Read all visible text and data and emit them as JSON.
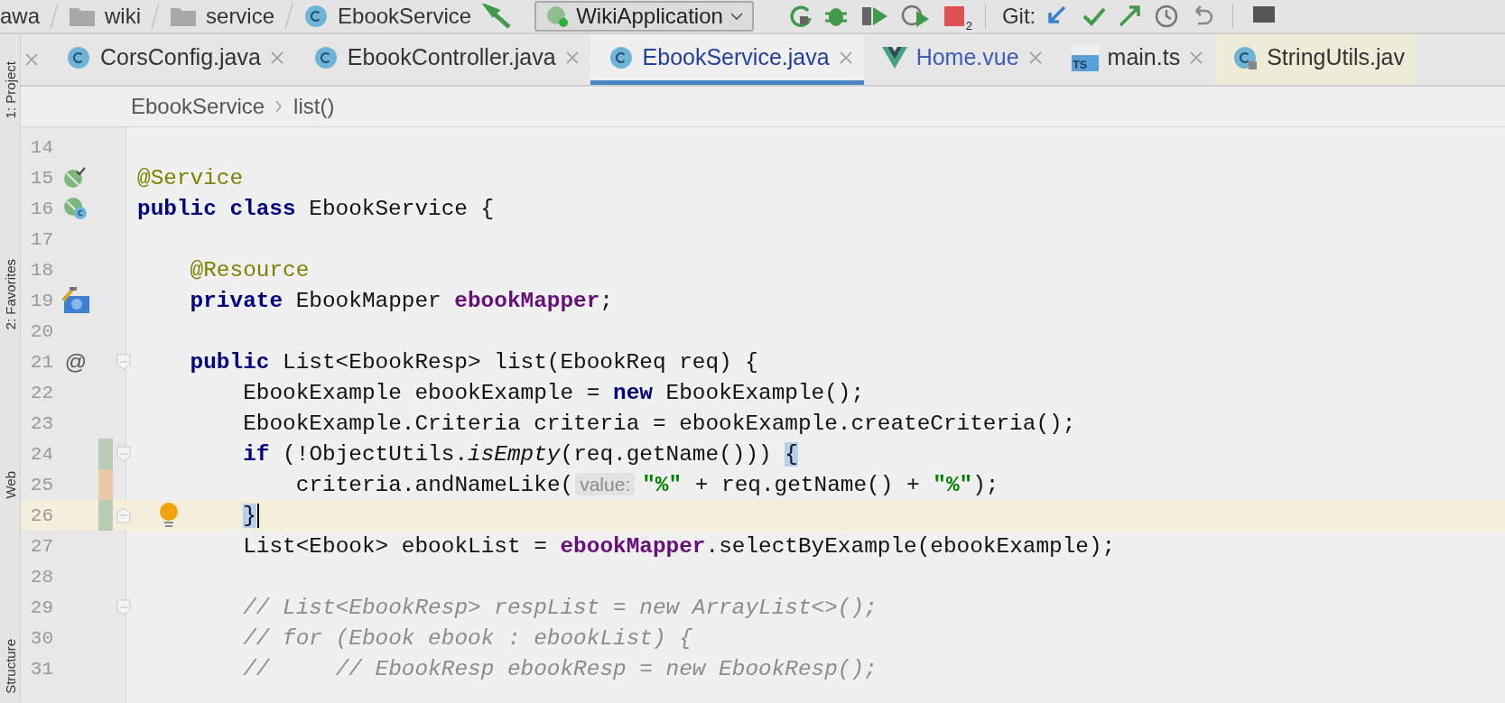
{
  "navbar": {
    "crumbs": [
      {
        "label": "awa",
        "kind": "plain"
      },
      {
        "label": "wiki",
        "kind": "folder"
      },
      {
        "label": "service",
        "kind": "folder"
      },
      {
        "label": "EbookService",
        "kind": "class"
      }
    ],
    "run_config": "WikiApplication",
    "stop_badge": "2",
    "git_label": "Git:"
  },
  "tool_strip": [
    {
      "label": "1: Project"
    },
    {
      "label": "2: Favorites"
    },
    {
      "label": "Web"
    },
    {
      "label": "Structure"
    }
  ],
  "tabs": [
    {
      "label": "CorsConfig.java",
      "kind": "class",
      "selected": false,
      "modified": false,
      "external": false
    },
    {
      "label": "EbookController.java",
      "kind": "class",
      "selected": false,
      "modified": false,
      "external": false
    },
    {
      "label": "EbookService.java",
      "kind": "class",
      "selected": true,
      "modified": false,
      "external": false
    },
    {
      "label": "Home.vue",
      "kind": "vue",
      "selected": false,
      "modified": true,
      "external": false
    },
    {
      "label": "main.ts",
      "kind": "ts",
      "icon_text": "TS",
      "selected": false,
      "modified": false,
      "external": false
    },
    {
      "label": "StringUtils.jav",
      "kind": "locked",
      "selected": false,
      "modified": false,
      "external": true
    }
  ],
  "breadcrumb": [
    "EbookService",
    "list()"
  ],
  "editor": {
    "lines": [
      {
        "number": "14",
        "current": false
      },
      {
        "number": "15",
        "current": false,
        "gutter": {
          "kind": "bean"
        },
        "tokens": [
          {
            "kind": "annotation",
            "text": "@Service"
          }
        ]
      },
      {
        "number": "16",
        "current": false,
        "gutter": {
          "kind": "beanclass"
        },
        "tokens": [
          {
            "kind": "keyword",
            "text": "public class"
          },
          {
            "kind": "plain",
            "text": " EbookService {"
          }
        ],
        "children": [
          {
            "number": "17",
            "current": false
          },
          {
            "number": "18",
            "current": false,
            "tokens": [
              {
                "kind": "annotation",
                "text": "@Resource"
              }
            ]
          },
          {
            "number": "19",
            "current": false,
            "gutter": {
              "kind": "autowired"
            },
            "tokens": [
              {
                "kind": "keyword",
                "text": "private"
              },
              {
                "kind": "plain",
                "text": " EbookMapper "
              },
              {
                "kind": "field",
                "text": "ebookMapper"
              },
              {
                "kind": "plain",
                "text": ";"
              }
            ]
          },
          {
            "number": "20",
            "current": false
          },
          {
            "number": "21",
            "current": false,
            "gutter_mark": "@",
            "fold": {
              "kind": "start"
            },
            "tokens": [
              {
                "kind": "keyword",
                "text": "public"
              },
              {
                "kind": "plain",
                "text": " List<EbookResp> list(EbookReq req) {"
              }
            ],
            "children": [
              {
                "number": "22",
                "current": false,
                "tokens": [
                  {
                    "kind": "plain",
                    "text": "EbookExample ebookExample = "
                  },
                  {
                    "kind": "keyword",
                    "text": "new"
                  },
                  {
                    "kind": "plain",
                    "text": " EbookExample();"
                  }
                ]
              },
              {
                "number": "23",
                "current": false,
                "tokens": [
                  {
                    "kind": "plain",
                    "text": "EbookExample.Criteria criteria = ebookExample.createCriteria();"
                  }
                ]
              },
              {
                "number": "24",
                "current": false,
                "change": {
                  "kind": "added"
                },
                "fold": {
                  "kind": "start"
                },
                "tokens": [
                  {
                    "kind": "keyword",
                    "text": "if"
                  },
                  {
                    "kind": "plain",
                    "text": " (!ObjectUtils."
                  },
                  {
                    "kind": "italic",
                    "text": "isEmpty"
                  },
                  {
                    "kind": "plain",
                    "text": "(req.getName())) "
                  },
                  {
                    "kind": "brace",
                    "text": "{"
                  }
                ],
                "children": [
                  {
                    "number": "25",
                    "current": false,
                    "change": {
                      "kind": "modified"
                    },
                    "tokens": [
                      {
                        "kind": "plain",
                        "text": "criteria.andNameLike("
                      },
                      {
                        "kind": "hint",
                        "text": "value:"
                      },
                      {
                        "kind": "string",
                        "text": "\"%\""
                      },
                      {
                        "kind": "plain",
                        "text": " + req.getName() + "
                      },
                      {
                        "kind": "string",
                        "text": "\"%\""
                      },
                      {
                        "kind": "plain",
                        "text": ");"
                      }
                    ]
                  }
                ]
              },
              {
                "number": "26",
                "current": true,
                "change": {
                  "kind": "added"
                },
                "fold": {
                  "kind": "end"
                },
                "bulb": true,
                "tokens": [
                  {
                    "kind": "brace",
                    "text": "}"
                  }
                ]
              },
              {
                "number": "27",
                "current": false,
                "tokens": [
                  {
                    "kind": "plain",
                    "text": "List<Ebook> ebookList = "
                  },
                  {
                    "kind": "field",
                    "text": "ebookMapper"
                  },
                  {
                    "kind": "plain",
                    "text": ".selectByExample(ebookExample);"
                  }
                ]
              },
              {
                "number": "28",
                "current": false
              },
              {
                "number": "29",
                "current": false,
                "fold": {
                  "kind": "start"
                },
                "tokens": [
                  {
                    "kind": "comment",
                    "text": "// List<EbookResp> respList = new ArrayList<>();"
                  }
                ]
              },
              {
                "number": "30",
                "current": false,
                "tokens": [
                  {
                    "kind": "comment",
                    "text": "// for (Ebook ebook : ebookList) {"
                  }
                ]
              },
              {
                "number": "31",
                "current": false,
                "tokens": [
                  {
                    "kind": "comment",
                    "text": "//     // EbookResp ebookResp = new EbookResp();"
                  }
                ]
              }
            ]
          }
        ]
      }
    ]
  }
}
